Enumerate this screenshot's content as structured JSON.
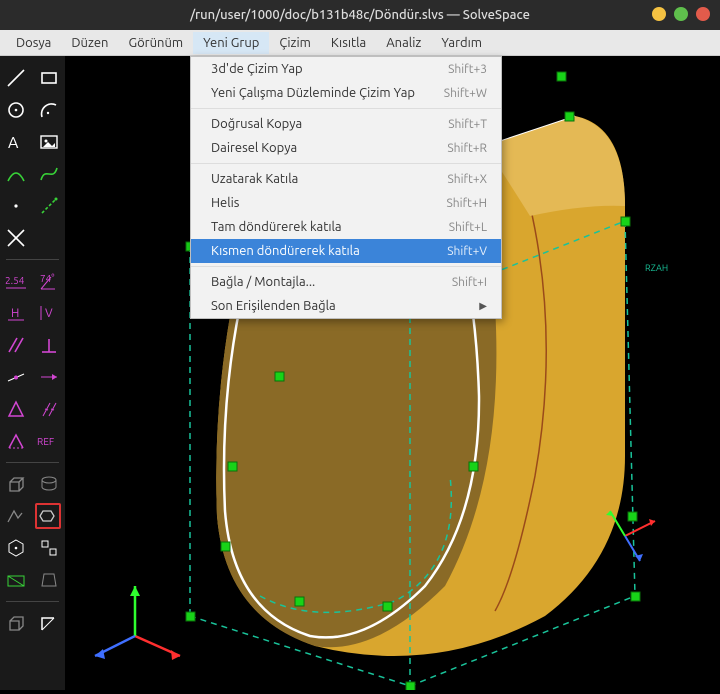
{
  "title": "/run/user/1000/doc/b131b48c/Döndür.slvs — SolveSpace",
  "menubar": {
    "items": [
      "Dosya",
      "Düzen",
      "Görünüm",
      "Yeni Grup",
      "Çizim",
      "Kısıtla",
      "Analiz",
      "Yardım"
    ],
    "open_index": 3
  },
  "dropdown": {
    "items": [
      {
        "label": "3d'de Çizim Yap",
        "shortcut": "Shift+3"
      },
      {
        "label": "Yeni Çalışma Düzleminde Çizim Yap",
        "shortcut": "Shift+W"
      },
      {
        "sep": true
      },
      {
        "label": "Doğrusal Kopya",
        "shortcut": "Shift+T"
      },
      {
        "label": "Dairesel Kopya",
        "shortcut": "Shift+R"
      },
      {
        "sep": true
      },
      {
        "label": "Uzatarak Katıla",
        "shortcut": "Shift+X"
      },
      {
        "label": "Helis",
        "shortcut": "Shift+H"
      },
      {
        "label": "Tam döndürerek katıla",
        "shortcut": "Shift+L"
      },
      {
        "label": "Kısmen döndürerek katıla",
        "shortcut": "Shift+V",
        "highlight": true
      },
      {
        "sep": true
      },
      {
        "label": "Bağla / Montajla...",
        "shortcut": "Shift+I"
      },
      {
        "label": "Son Erişilenden Bağla",
        "submenu": true
      }
    ]
  },
  "toolbar": {
    "angle_label_left": "2.54",
    "angle_label_right": "74°",
    "ref_label": "REF"
  },
  "colors": {
    "solid": "#d9a62e",
    "solid_shadow": "#7a5a1a",
    "edge_light": "#ffffff",
    "construction": "#19c39a",
    "handle": "#18d318",
    "axis_x": "#ff2f2f",
    "axis_y": "#2fff2f",
    "axis_z": "#3f6fff"
  }
}
